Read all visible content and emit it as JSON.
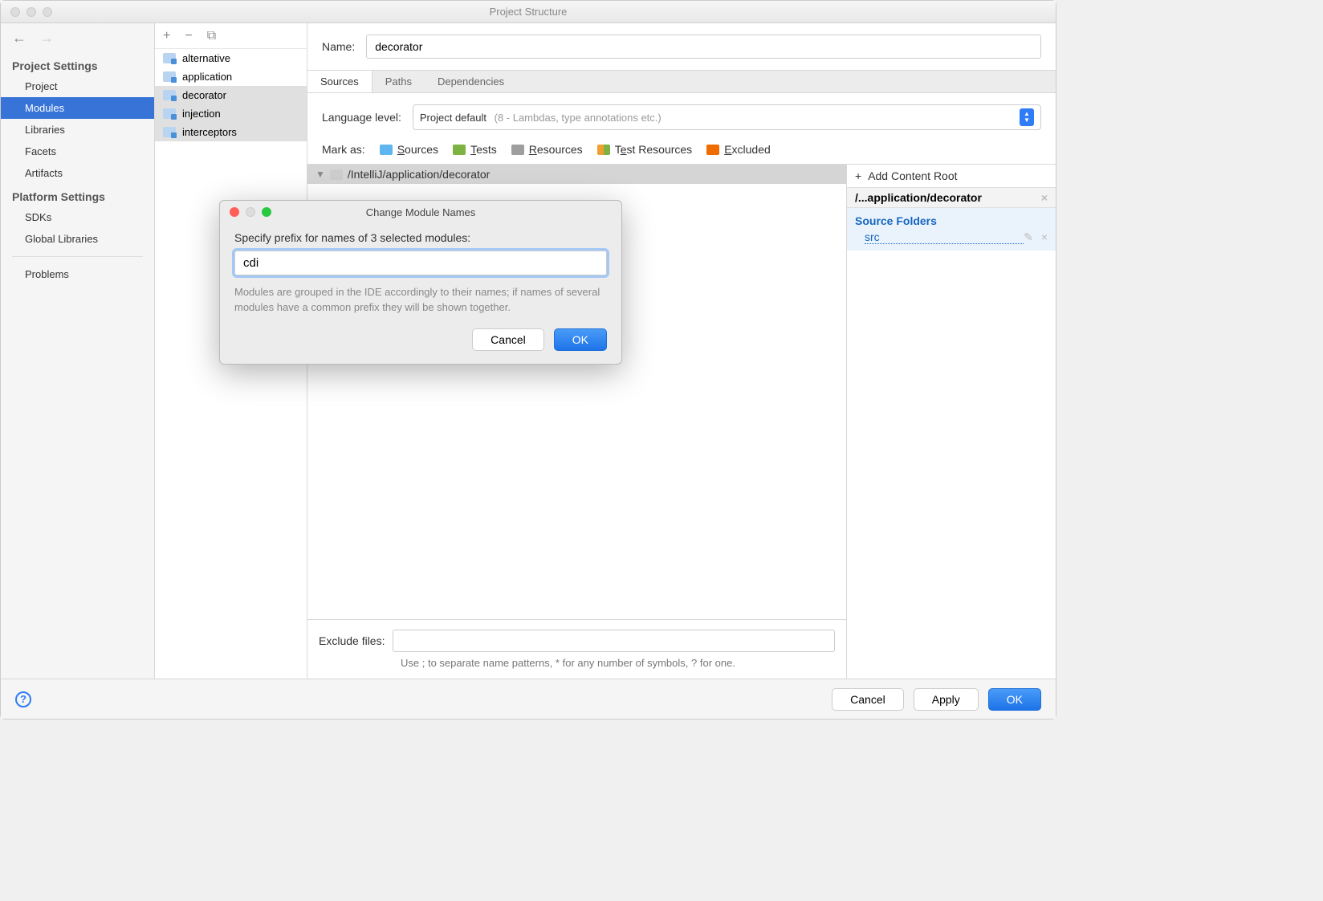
{
  "window": {
    "title": "Project Structure"
  },
  "sidebar": {
    "section1": "Project Settings",
    "items1": [
      "Project",
      "Modules",
      "Libraries",
      "Facets",
      "Artifacts"
    ],
    "section2": "Platform Settings",
    "items2": [
      "SDKs",
      "Global Libraries"
    ],
    "problems": "Problems"
  },
  "modules": {
    "items": [
      "alternative",
      "application",
      "decorator",
      "injection",
      "interceptors"
    ]
  },
  "content": {
    "name_label": "Name:",
    "name_value": "decorator",
    "tabs": [
      "Sources",
      "Paths",
      "Dependencies"
    ],
    "lang_label": "Language level:",
    "lang_value": "Project default",
    "lang_hint": "(8 - Lambdas, type annotations etc.)",
    "markas_label": "Mark as:",
    "mark": {
      "sources": "Sources",
      "tests": "Tests",
      "resources": "Resources",
      "testres": "Test Resources",
      "excluded": "Excluded"
    },
    "tree_path": "/IntelliJ/application/decorator",
    "exclude_label": "Exclude files:",
    "exclude_hint": "Use ; to separate name patterns, * for any number of symbols, ? for one."
  },
  "rightpane": {
    "add_root": "Add Content Root",
    "root_path": "/...application/decorator",
    "src_header": "Source Folders",
    "src_item": "src"
  },
  "footer": {
    "cancel": "Cancel",
    "apply": "Apply",
    "ok": "OK"
  },
  "modal": {
    "title": "Change Module Names",
    "label": "Specify prefix for names of 3 selected modules:",
    "value": "cdi",
    "hint": "Modules are grouped in the IDE accordingly to their names; if names of several modules have a common prefix they will be shown together.",
    "cancel": "Cancel",
    "ok": "OK"
  }
}
